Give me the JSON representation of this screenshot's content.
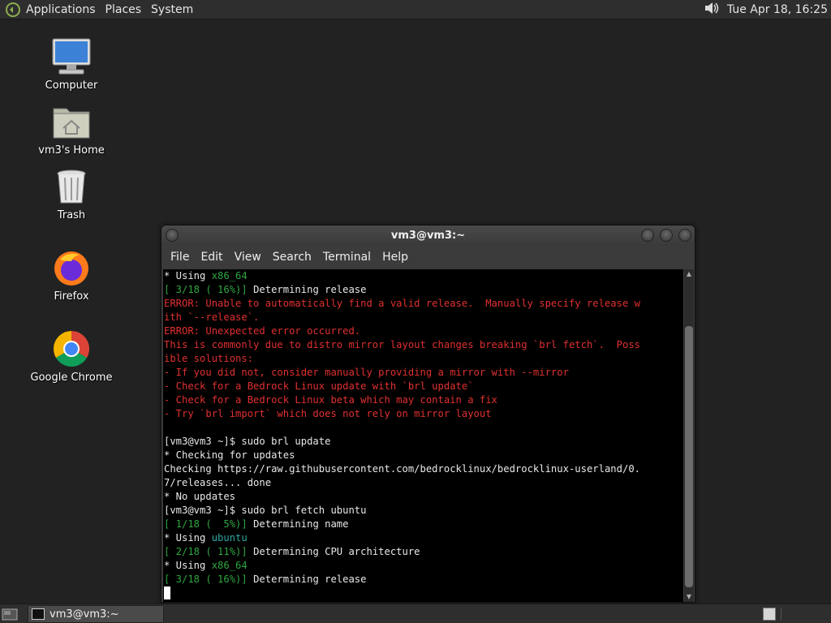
{
  "top_panel": {
    "menus": [
      "Applications",
      "Places",
      "System"
    ],
    "clock": "Tue Apr 18, 16:25",
    "icons": {
      "logo": "distro-logo-icon",
      "volume": "volume-icon"
    }
  },
  "desktop": {
    "icons": [
      {
        "label": "Computer",
        "icon": "computer-icon"
      },
      {
        "label": "vm3's Home",
        "icon": "home-folder-icon"
      },
      {
        "label": "Trash",
        "icon": "trash-icon"
      },
      {
        "label": "Firefox",
        "icon": "firefox-icon"
      },
      {
        "label": "Google Chrome",
        "icon": "chrome-icon"
      }
    ]
  },
  "terminal": {
    "title": "vm3@vm3:~",
    "menus": [
      "File",
      "Edit",
      "View",
      "Search",
      "Terminal",
      "Help"
    ],
    "lines": [
      [
        {
          "t": "* Using ",
          "c": ""
        },
        {
          "t": "x86_64",
          "c": "green"
        }
      ],
      [
        {
          "t": "[ 3/18 ( 16%)]",
          "c": "green"
        },
        {
          "t": " Determining release",
          "c": ""
        }
      ],
      [
        {
          "t": "ERROR: Unable to automatically find a valid release.  Manually specify release w",
          "c": "red"
        }
      ],
      [
        {
          "t": "ith `--release`.",
          "c": "red"
        }
      ],
      [
        {
          "t": "ERROR: Unexpected error occurred.",
          "c": "red"
        }
      ],
      [
        {
          "t": "This is commonly due to distro mirror layout changes breaking `brl fetch`.  Poss",
          "c": "red"
        }
      ],
      [
        {
          "t": "ible solutions:",
          "c": "red"
        }
      ],
      [
        {
          "t": "- If you did not, consider manually providing a mirror with --mirror",
          "c": "red"
        }
      ],
      [
        {
          "t": "- Check for a Bedrock Linux update with `brl update`",
          "c": "red"
        }
      ],
      [
        {
          "t": "- Check for a Bedrock Linux beta which may contain a fix",
          "c": "red"
        }
      ],
      [
        {
          "t": "- Try `brl import` which does not rely on mirror layout",
          "c": "red"
        }
      ],
      [
        {
          "t": "",
          "c": ""
        }
      ],
      [
        {
          "t": "[vm3@vm3 ~]$ sudo brl update",
          "c": ""
        }
      ],
      [
        {
          "t": "* Checking for updates",
          "c": ""
        }
      ],
      [
        {
          "t": "Checking https://raw.githubusercontent.com/bedrocklinux/bedrocklinux-userland/0.",
          "c": ""
        }
      ],
      [
        {
          "t": "7/releases... done",
          "c": ""
        }
      ],
      [
        {
          "t": "* No updates",
          "c": ""
        }
      ],
      [
        {
          "t": "[vm3@vm3 ~]$ sudo brl fetch ubuntu",
          "c": ""
        }
      ],
      [
        {
          "t": "[ 1/18 (  5%)]",
          "c": "green"
        },
        {
          "t": " Determining name",
          "c": ""
        }
      ],
      [
        {
          "t": "* Using ",
          "c": ""
        },
        {
          "t": "ubuntu",
          "c": "cyan"
        }
      ],
      [
        {
          "t": "[ 2/18 ( 11%)]",
          "c": "green"
        },
        {
          "t": " Determining CPU architecture",
          "c": ""
        }
      ],
      [
        {
          "t": "* Using ",
          "c": ""
        },
        {
          "t": "x86_64",
          "c": "green"
        }
      ],
      [
        {
          "t": "[ 3/18 ( 16%)]",
          "c": "green"
        },
        {
          "t": " Determining release",
          "c": ""
        }
      ]
    ]
  },
  "bottom_panel": {
    "task_label": "vm3@vm3:~"
  }
}
